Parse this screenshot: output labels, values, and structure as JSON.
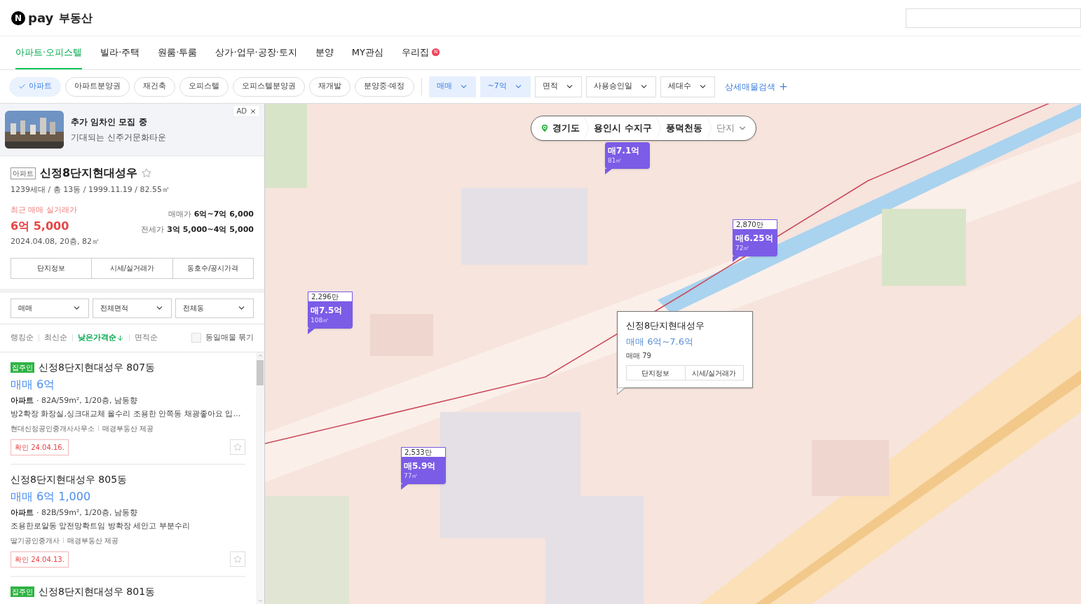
{
  "header": {
    "logo_mark": "N",
    "logo_text": "pay",
    "title": "부동산"
  },
  "tabs": [
    {
      "label": "아파트·오피스텔",
      "selected": true
    },
    {
      "label": "빌라·주택",
      "selected": false
    },
    {
      "label": "원룸·투룸",
      "selected": false
    },
    {
      "label": "상가·업무·공장·토지",
      "selected": false
    },
    {
      "label": "분양",
      "selected": false
    },
    {
      "label": "MY관심",
      "selected": false
    },
    {
      "label": "우리집",
      "selected": false,
      "badge": "N"
    }
  ],
  "chips": [
    {
      "label": "아파트",
      "selected": true
    },
    {
      "label": "아파트분양권",
      "selected": false
    },
    {
      "label": "재건축",
      "selected": false
    },
    {
      "label": "오피스텔",
      "selected": false
    },
    {
      "label": "오피스텔분양권",
      "selected": false
    },
    {
      "label": "재개발",
      "selected": false
    },
    {
      "label": "분양중·예정",
      "selected": false
    }
  ],
  "dropdowns": [
    {
      "label": "매매",
      "selected": true
    },
    {
      "label": "~7억",
      "selected": true
    },
    {
      "label": "면적",
      "selected": false
    },
    {
      "label": "사용승인일",
      "selected": false
    },
    {
      "label": "세대수",
      "selected": false
    }
  ],
  "detail_search": "상세매물검색",
  "ad": {
    "badge": "AD",
    "title": "추가 임차인 모집 중",
    "subtitle": "기대되는 신주거문화타운"
  },
  "complex": {
    "type": "아파트",
    "name": "신정8단지현대성우",
    "favorite": false,
    "summary": "1239세대 / 총 13동 / 1999.11.19 / 82.55㎡",
    "recent_label": "최근 매매 실거래가",
    "recent_price": "6억 5,000",
    "recent_detail": "2024.04.08, 20층, 82㎡",
    "prices": [
      {
        "label": "매매가",
        "value": "6억~7억 6,000"
      },
      {
        "label": "전세가",
        "value": "3억 5,000~4억 5,000"
      }
    ],
    "buttons": [
      "단지정보",
      "시세/실거래가",
      "동호수/공시가격"
    ]
  },
  "list_filters": [
    "매매",
    "전체면적",
    "전체동"
  ],
  "sort": [
    {
      "label": "랭킹순",
      "selected": false
    },
    {
      "label": "최신순",
      "selected": false
    },
    {
      "label": "낮은가격순",
      "selected": true
    },
    {
      "label": "면적순",
      "selected": false
    }
  ],
  "group_toggle": {
    "label": "동일매물 묶기",
    "checked": false
  },
  "listings": [
    {
      "badge": "집주인",
      "title": "신정8단지현대성우 807동",
      "price": "매매 6억",
      "spec_type": "아파트",
      "spec": "· 82A/59m², 1/20층, 남동향",
      "description": "방2확장 화장실,싱크대교체 올수리 조용한 안쪽동 채광좋아요 입…",
      "agency": "현대신정공인중개사사무소",
      "provider": "매경부동산 제공",
      "confirmed": "확인 24.04.16."
    },
    {
      "title": "신정8단지현대성우 805동",
      "price": "매매 6억 1,000",
      "spec_type": "아파트",
      "spec": "· 82B/59m², 1/20층, 남동향",
      "description": "조용한로얄동 앞전망확트임 방확장 세안고 부분수리",
      "agency": "딸기공인중개사",
      "provider": "매경부동산 제공",
      "confirmed": "확인 24.04.13."
    },
    {
      "badge": "집주인",
      "title": "신정8단지현대성우 801동"
    }
  ],
  "map": {
    "breadcrumb": [
      {
        "kind": "region",
        "label": "경기도"
      },
      {
        "kind": "region",
        "label": "용인시 수지구"
      },
      {
        "kind": "region",
        "label": "풍덕천동"
      },
      {
        "kind": "mode",
        "label": "단지"
      }
    ],
    "markers": [
      {
        "price": "매7.1억",
        "area": "81㎡"
      },
      {
        "top": "2,870만",
        "price": "매6.25억",
        "area": "72㎡"
      },
      {
        "top": "2,296만",
        "price": "매7.5억",
        "area": "108㎡"
      },
      {
        "top": "2,533만",
        "price": "매5.9억",
        "area": "77㎡"
      }
    ],
    "popup": {
      "name": "신정8단지현대성우",
      "price": "매매 6억~7.6억",
      "count": "매매 79",
      "buttons": [
        "단지정보",
        "시세/실거래가"
      ]
    }
  }
}
